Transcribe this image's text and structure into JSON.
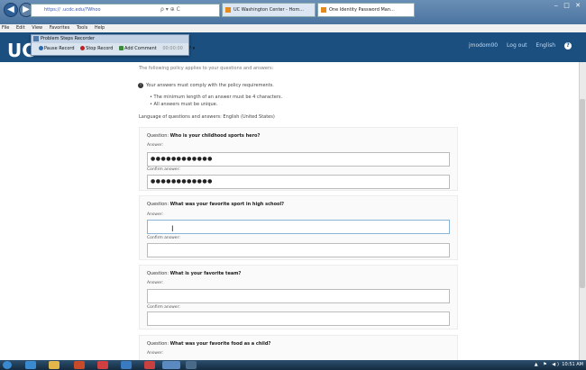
{
  "browser": {
    "url": "https://            .ucdc.edu/?Whoo",
    "addr_controls": "ρ ▾ ⊕ C",
    "tabs": [
      {
        "label": "UC Washington Center - Hom..."
      },
      {
        "label": "One Identity Password Man..."
      }
    ],
    "window_controls": "‒ □ ✕",
    "menu": [
      "File",
      "Edit",
      "View",
      "Favorites",
      "Tools",
      "Help"
    ]
  },
  "recorder": {
    "title": "Problem Steps Recorder",
    "pause": "Pause Record",
    "stop": "Stop Record",
    "comment": "Add Comment",
    "counter": "00:00:00",
    "help": "? ▾"
  },
  "site": {
    "logo": "UC",
    "username": "jmodom00",
    "logout": "Log out",
    "language": "English",
    "help_icon": "?"
  },
  "policy": {
    "intro": "The following policy applies to your questions and answers:",
    "heading": "Your answers must comply with the policy requirements.",
    "rules": [
      "• The minimum length of an answer must be 4 characters.",
      "• All answers must be unique."
    ],
    "language_line": "Language of questions and answers: English (United States)"
  },
  "questions": [
    {
      "prefix": "Question: ",
      "text": "Who is your childhood sports hero?",
      "answer_label": "Answer:",
      "answer": "●●●●●●●●●●●●",
      "confirm_label": "Confirm answer:",
      "confirm": "●●●●●●●●●●●●"
    },
    {
      "prefix": "Question: ",
      "text": "What was your favorite sport in high school?",
      "answer_label": "Answer:",
      "answer": "",
      "confirm_label": "Confirm answer:",
      "confirm": ""
    },
    {
      "prefix": "Question: ",
      "text": "What is your favorite team?",
      "answer_label": "Answer:",
      "answer": "",
      "confirm_label": "Confirm answer:",
      "confirm": ""
    },
    {
      "prefix": "Question: ",
      "text": "What was your favorite food as a child?",
      "answer_label": "Answer:"
    }
  ],
  "taskbar": {
    "tray": "▲ ⚑ ◀)",
    "clock": "10:51 AM"
  },
  "colors": {
    "header": "#1a4f80",
    "taskbar": "#142b40"
  }
}
